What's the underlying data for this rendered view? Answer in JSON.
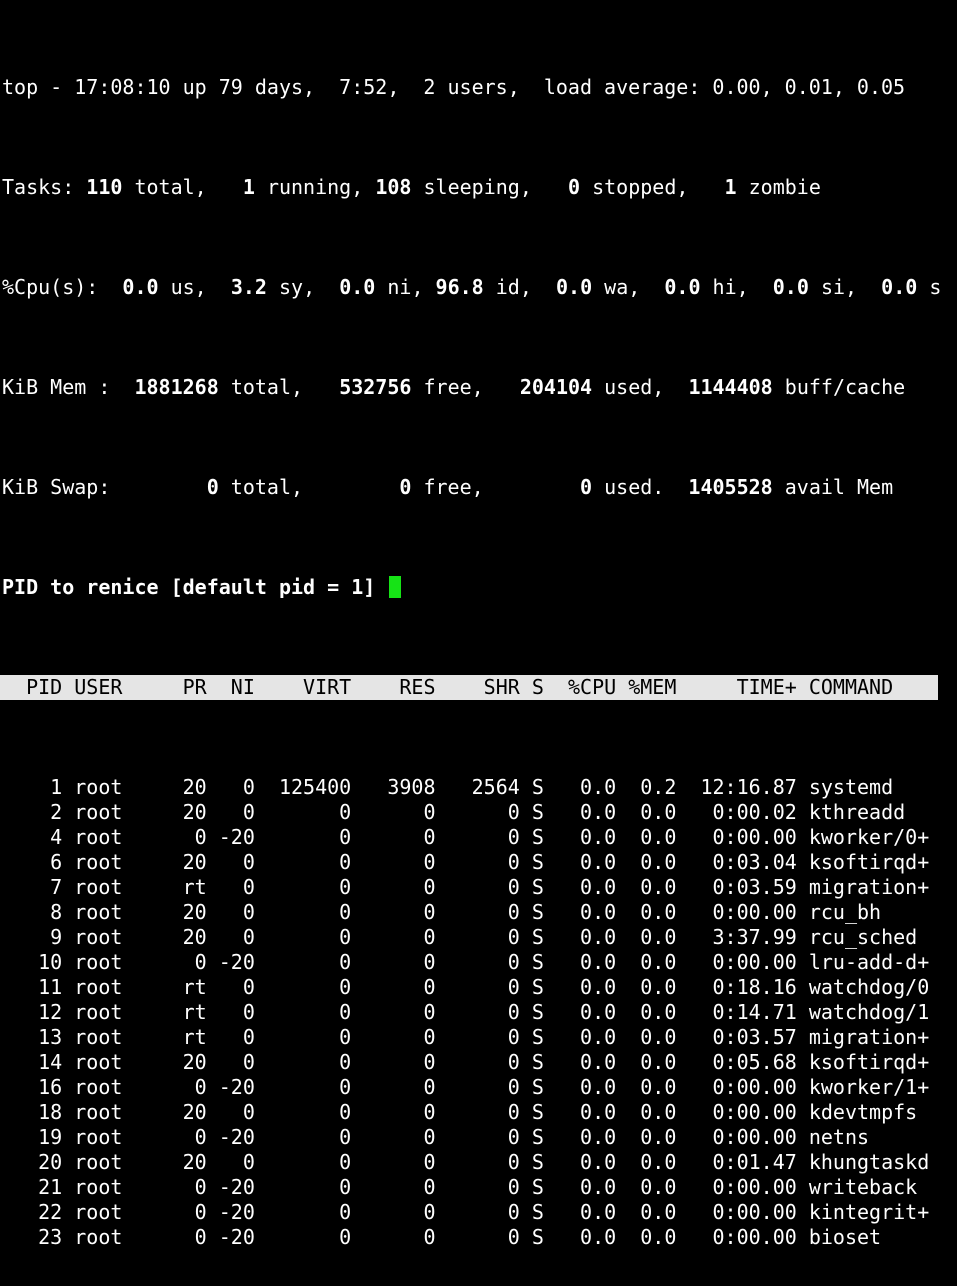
{
  "colors": {
    "background": "#000000",
    "text": "#ffffff",
    "header_bg": "#e5e5e5",
    "header_text": "#000000",
    "cursor": "#16e316"
  },
  "summary": {
    "uptime_line": "top - 17:08:10 up 79 days,  7:52,  2 users,  load average: 0.00, 0.01, 0.05",
    "tasks": {
      "label": "Tasks:",
      "total": "110",
      "total_label": "total,",
      "running": "1",
      "running_label": "running,",
      "sleeping": "108",
      "sleeping_label": "sleeping,",
      "stopped": "0",
      "stopped_label": "stopped,",
      "zombie": "1",
      "zombie_label": "zombie"
    },
    "cpu": {
      "label": "%Cpu(s):",
      "us": "0.0",
      "us_label": "us,",
      "sy": "3.2",
      "sy_label": "sy,",
      "ni": "0.0",
      "ni_label": "ni,",
      "id": "96.8",
      "id_label": "id,",
      "wa": "0.0",
      "wa_label": "wa,",
      "hi": "0.0",
      "hi_label": "hi,",
      "si": "0.0",
      "si_label": "si,",
      "st": "0.0",
      "st_label": "s"
    },
    "mem": {
      "label": "KiB Mem :",
      "total": "1881268",
      "total_label": "total,",
      "free": "532756",
      "free_label": "free,",
      "used": "204104",
      "used_label": "used,",
      "buff": "1144408",
      "buff_label": "buff/cache"
    },
    "swap": {
      "label": "KiB Swap:",
      "total": "0",
      "total_label": "total,",
      "free": "0",
      "free_label": "free,",
      "used": "0",
      "used_label": "used.",
      "avail": "1405528",
      "avail_label": "avail Mem"
    }
  },
  "prompt": {
    "text": "PID to renice [default pid = 1]"
  },
  "table": {
    "columns": [
      "PID",
      "USER",
      "PR",
      "NI",
      "VIRT",
      "RES",
      "SHR",
      "S",
      "%CPU",
      "%MEM",
      "TIME+",
      "COMMAND"
    ],
    "rows": [
      [
        "1",
        "root",
        "20",
        "0",
        "125400",
        "3908",
        "2564",
        "S",
        "0.0",
        "0.2",
        "12:16.87",
        "systemd"
      ],
      [
        "2",
        "root",
        "20",
        "0",
        "0",
        "0",
        "0",
        "S",
        "0.0",
        "0.0",
        "0:00.02",
        "kthreadd"
      ],
      [
        "4",
        "root",
        "0",
        "-20",
        "0",
        "0",
        "0",
        "S",
        "0.0",
        "0.0",
        "0:00.00",
        "kworker/0+"
      ],
      [
        "6",
        "root",
        "20",
        "0",
        "0",
        "0",
        "0",
        "S",
        "0.0",
        "0.0",
        "0:03.04",
        "ksoftirqd+"
      ],
      [
        "7",
        "root",
        "rt",
        "0",
        "0",
        "0",
        "0",
        "S",
        "0.0",
        "0.0",
        "0:03.59",
        "migration+"
      ],
      [
        "8",
        "root",
        "20",
        "0",
        "0",
        "0",
        "0",
        "S",
        "0.0",
        "0.0",
        "0:00.00",
        "rcu_bh"
      ],
      [
        "9",
        "root",
        "20",
        "0",
        "0",
        "0",
        "0",
        "S",
        "0.0",
        "0.0",
        "3:37.99",
        "rcu_sched"
      ],
      [
        "10",
        "root",
        "0",
        "-20",
        "0",
        "0",
        "0",
        "S",
        "0.0",
        "0.0",
        "0:00.00",
        "lru-add-d+"
      ],
      [
        "11",
        "root",
        "rt",
        "0",
        "0",
        "0",
        "0",
        "S",
        "0.0",
        "0.0",
        "0:18.16",
        "watchdog/0"
      ],
      [
        "12",
        "root",
        "rt",
        "0",
        "0",
        "0",
        "0",
        "S",
        "0.0",
        "0.0",
        "0:14.71",
        "watchdog/1"
      ],
      [
        "13",
        "root",
        "rt",
        "0",
        "0",
        "0",
        "0",
        "S",
        "0.0",
        "0.0",
        "0:03.57",
        "migration+"
      ],
      [
        "14",
        "root",
        "20",
        "0",
        "0",
        "0",
        "0",
        "S",
        "0.0",
        "0.0",
        "0:05.68",
        "ksoftirqd+"
      ],
      [
        "16",
        "root",
        "0",
        "-20",
        "0",
        "0",
        "0",
        "S",
        "0.0",
        "0.0",
        "0:00.00",
        "kworker/1+"
      ],
      [
        "18",
        "root",
        "20",
        "0",
        "0",
        "0",
        "0",
        "S",
        "0.0",
        "0.0",
        "0:00.00",
        "kdevtmpfs"
      ],
      [
        "19",
        "root",
        "0",
        "-20",
        "0",
        "0",
        "0",
        "S",
        "0.0",
        "0.0",
        "0:00.00",
        "netns"
      ],
      [
        "20",
        "root",
        "20",
        "0",
        "0",
        "0",
        "0",
        "S",
        "0.0",
        "0.0",
        "0:01.47",
        "khungtaskd"
      ],
      [
        "21",
        "root",
        "0",
        "-20",
        "0",
        "0",
        "0",
        "S",
        "0.0",
        "0.0",
        "0:00.00",
        "writeback"
      ],
      [
        "22",
        "root",
        "0",
        "-20",
        "0",
        "0",
        "0",
        "S",
        "0.0",
        "0.0",
        "0:00.00",
        "kintegrit+"
      ],
      [
        "23",
        "root",
        "0",
        "-20",
        "0",
        "0",
        "0",
        "S",
        "0.0",
        "0.0",
        "0:00.00",
        "bioset"
      ]
    ]
  }
}
